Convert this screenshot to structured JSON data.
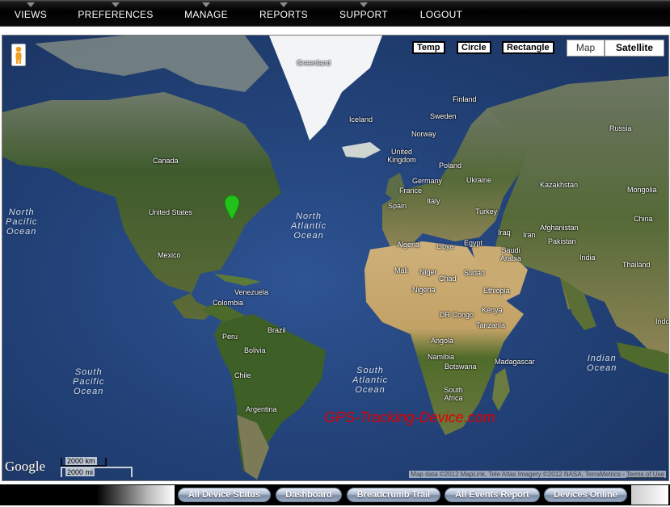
{
  "nav": {
    "items": [
      {
        "label": "VIEWS",
        "has_menu": true
      },
      {
        "label": "PREFERENCES",
        "has_menu": true
      },
      {
        "label": "MANAGE",
        "has_menu": true
      },
      {
        "label": "REPORTS",
        "has_menu": true
      },
      {
        "label": "SUPPORT",
        "has_menu": true
      },
      {
        "label": "LOGOUT",
        "has_menu": false
      }
    ]
  },
  "map": {
    "tools": {
      "temp": "Temp",
      "circle": "Circle",
      "rectangle": "Rectangle"
    },
    "map_type": {
      "map": "Map",
      "satellite": "Satellite",
      "selected": "Satellite"
    },
    "countries": [
      "Greenland",
      "Iceland",
      "Finland",
      "Sweden",
      "Norway",
      "Russia",
      "United Kingdom",
      "Poland",
      "Germany",
      "Ukraine",
      "France",
      "Italy",
      "Spain",
      "Turkey",
      "Kazakhstan",
      "Mongolia",
      "China",
      "Iraq",
      "Iran",
      "Afghanistan",
      "Pakistan",
      "India",
      "Thailand",
      "Saudi Arabia",
      "Egypt",
      "Libya",
      "Algeria",
      "Mali",
      "Niger",
      "Chad",
      "Sudan",
      "Nigeria",
      "Ethiopia",
      "DR Congo",
      "Kenya",
      "Tanzania",
      "Angola",
      "Namibia",
      "Botswana",
      "South Africa",
      "Madagascar",
      "Canada",
      "United States",
      "Mexico",
      "Venezuela",
      "Colombia",
      "Peru",
      "Brazil",
      "Bolivia",
      "Chile",
      "Argentina",
      "Indo"
    ],
    "oceans": [
      "North\nPacific\nOcean",
      "North\nAtlantic\nOcean",
      "South\nPacific\nOcean",
      "South\nAtlantic\nOcean",
      "Indian\nOcean"
    ],
    "watermark": "GPS-Tracking-Device.com",
    "google_logo": "Google",
    "scale": {
      "km": "2000 km",
      "mi": "2000 mi"
    },
    "attribution": "Map data ©2012 MapLink, Tele Atlas Imagery ©2012 NASA, TerraMetrics - ",
    "terms_link": "Terms of Use",
    "marker_color": "#22c21a",
    "pegman_icon": "pegman-icon"
  },
  "bottom": {
    "buttons": [
      "All Device Status",
      "Dashboard",
      "Breadcrumb Trail",
      "All Events Report",
      "Devices Online"
    ]
  },
  "colors": {
    "ocean": "#23437a",
    "land_green": "#4d6b33",
    "desert": "#c2a46a",
    "ice": "#f2f4f6",
    "watermark": "#e00000"
  }
}
